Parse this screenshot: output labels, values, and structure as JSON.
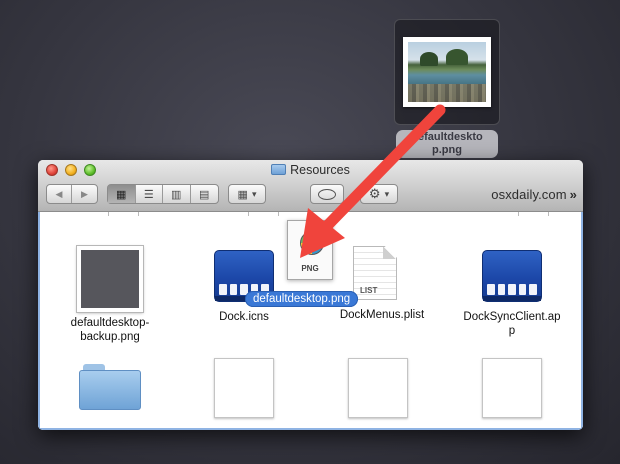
{
  "desktop_file": {
    "name_line1": "defaultdeskto",
    "name_line2": "p.png"
  },
  "window": {
    "title": "Resources",
    "site_label": "osxdaily.com",
    "site_chevron": "»"
  },
  "toolbar": {
    "back": "◀",
    "forward": "▶",
    "view_icon": "▦",
    "view_list": "☰",
    "view_column": "▥",
    "view_coverflow": "▤",
    "arrange": "▦",
    "action": "⚙",
    "chevron": "▾"
  },
  "items": [
    {
      "name_line1": "defaultdesktop-",
      "name_line2": "backup.png",
      "icon": "dark-image-thumbnail"
    },
    {
      "name_line1": "Dock.icns",
      "name_line2": "",
      "icon": "dock-icon"
    },
    {
      "name_line1": "DockMenus.plist",
      "name_line2": "",
      "icon": "plist-document-icon"
    },
    {
      "name_line1": "DockSyncClient.ap",
      "name_line2": "p",
      "icon": "dock-icon"
    },
    {
      "name_line1": "",
      "name_line2": "",
      "icon": "folder-icon"
    },
    {
      "name_line1": "",
      "name_line2": "",
      "icon": "blank-thumbnail"
    },
    {
      "name_line1": "",
      "name_line2": "",
      "icon": "blank-thumbnail"
    },
    {
      "name_line1": "",
      "name_line2": "",
      "icon": "blank-thumbnail"
    }
  ],
  "plist_tag": "LIST",
  "dragged": {
    "doc_tag": "PNG",
    "label": "defaultdesktop.png"
  },
  "colors": {
    "arrow": "#f0443c",
    "selection": "#3a78d6"
  }
}
